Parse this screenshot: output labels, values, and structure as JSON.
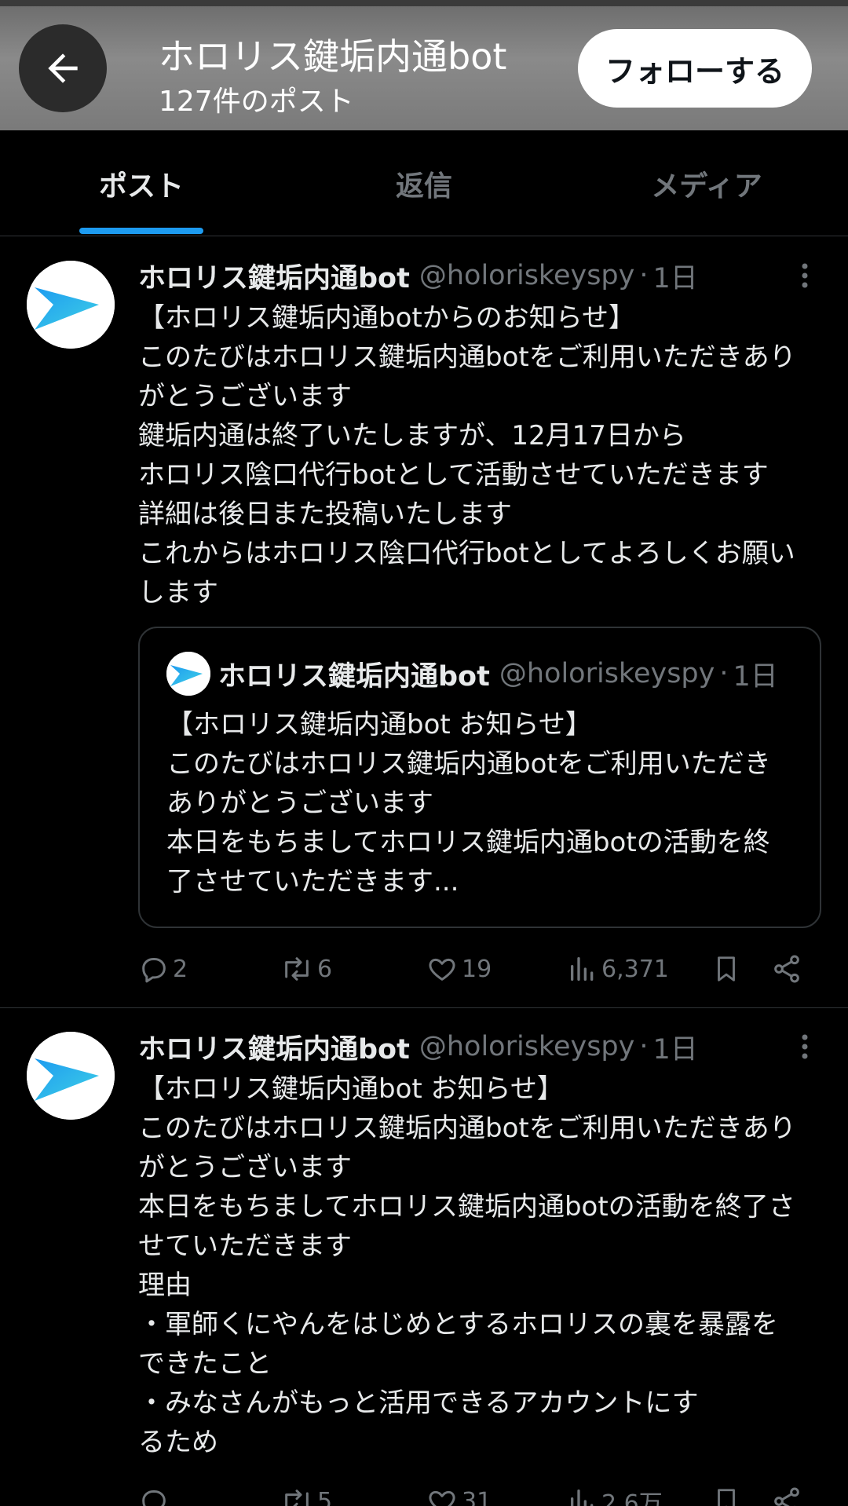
{
  "header": {
    "title": "ホロリス鍵垢内通bot",
    "subtitle": "127件のポスト",
    "follow_label": "フォローする"
  },
  "tabs": [
    {
      "label": "ポスト",
      "active": true
    },
    {
      "label": "返信",
      "active": false
    },
    {
      "label": "メディア",
      "active": false
    }
  ],
  "posts": [
    {
      "name": "ホロリス鍵垢内通bot",
      "handle": "@holoriskeyspy",
      "dot": "·",
      "time": "1日",
      "lines": [
        "【ホロリス鍵垢内通botからのお知らせ】",
        "このたびはホロリス鍵垢内通botをご利用いただきあり",
        "がとうございます",
        "鍵垢内通は終了いたしますが、12月17日から",
        "ホロリス陰口代行botとして活動させていただきます",
        "詳細は後日また投稿いたします",
        "これからはホロリス陰口代行botとしてよろしくお願い",
        "します"
      ],
      "quote": {
        "name": "ホロリス鍵垢内通bot",
        "handle": "@holoriskeyspy",
        "dot": "·",
        "time": "1日",
        "lines": [
          "【ホロリス鍵垢内通bot お知らせ】",
          "このたびはホロリス鍵垢内通botをご利用いただき",
          "ありがとうございます",
          "本日をもちましてホロリス鍵垢内通botの活動を終",
          "了させていただきます..."
        ]
      },
      "stats": {
        "replies": "2",
        "reposts": "6",
        "likes": "19",
        "views": "6,371"
      }
    },
    {
      "name": "ホロリス鍵垢内通bot",
      "handle": "@holoriskeyspy",
      "dot": "·",
      "time": "1日",
      "lines": [
        "【ホロリス鍵垢内通bot お知らせ】",
        "このたびはホロリス鍵垢内通botをご利用いただきあり",
        "がとうございます",
        "本日をもちましてホロリス鍵垢内通botの活動を終了さ",
        "せていただきます",
        "理由",
        "・軍師くにやんをはじめとするホロリスの裏を暴露を",
        "できたこと",
        "・みなさんがもっと活用できるアカウントにす",
        "るため"
      ],
      "stats": {
        "replies": "",
        "reposts": "5",
        "likes": "31",
        "views": "2.6万"
      }
    }
  ],
  "colors": {
    "background": "#000000",
    "text": "#e7e9ea",
    "muted": "#71767b",
    "accent": "#1d9bf0",
    "divider": "#2f3336"
  },
  "icons": {
    "back": "arrow-left-icon",
    "more": "more-vertical-icon",
    "reply": "reply-icon",
    "repost": "repost-icon",
    "like": "heart-icon",
    "views": "views-icon",
    "bookmark": "bookmark-icon",
    "share": "share-icon"
  }
}
